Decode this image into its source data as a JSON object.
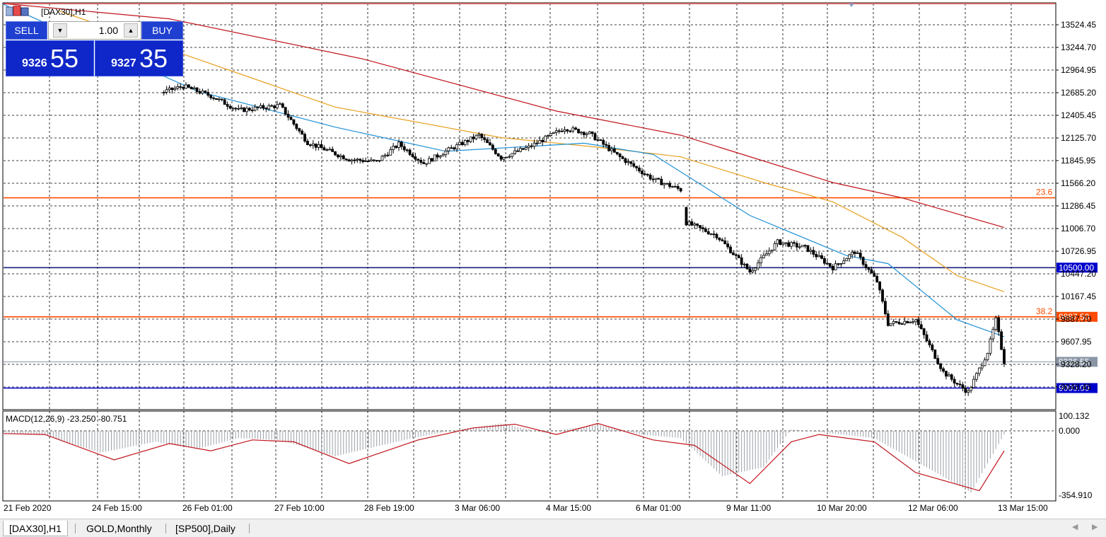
{
  "window": {
    "symbol_title": "[DAX30],H1"
  },
  "trade_panel": {
    "sell_label": "SELL",
    "buy_label": "BUY",
    "lot_value": "1.00",
    "sell_price_small": "9326",
    "sell_price_big": "55",
    "buy_price_small": "9327",
    "buy_price_big": "35"
  },
  "tabs": [
    {
      "label": "[DAX30],H1",
      "active": true
    },
    {
      "label": "GOLD,Monthly",
      "active": false
    },
    {
      "label": "[SP500],Daily",
      "active": false
    }
  ],
  "chart_data": {
    "type": "candlestick",
    "symbol": "[DAX30],H1",
    "ylim": [
      8900,
      13800
    ],
    "y_ticks": [
      "13524.45",
      "13244.70",
      "12964.95",
      "12685.20",
      "12405.45",
      "12125.70",
      "11845.95",
      "11566.20",
      "11286.45",
      "11006.70",
      "10726.95",
      "10447.20",
      "10167.45",
      "9887.70",
      "9607.95",
      "9328.20",
      "9048.45"
    ],
    "x_tick_labels": [
      "21 Feb 2020",
      "24 Feb 15:00",
      "26 Feb 01:00",
      "27 Feb 10:00",
      "28 Feb 19:00",
      "3 Mar 06:00",
      "4 Mar 15:00",
      "6 Mar 01:00",
      "9 Mar 11:00",
      "10 Mar 20:00",
      "12 Mar 06:00",
      "13 Mar 15:00"
    ],
    "price_path": [
      {
        "bar": 0,
        "price": 13700
      },
      {
        "bar": 25,
        "price": 13500
      },
      {
        "bar": 45,
        "price": 12900
      },
      {
        "bar": 57,
        "price": 12680
      },
      {
        "bar": 65,
        "price": 12760
      },
      {
        "bar": 75,
        "price": 12640
      },
      {
        "bar": 85,
        "price": 12460
      },
      {
        "bar": 100,
        "price": 12520
      },
      {
        "bar": 110,
        "price": 12060
      },
      {
        "bar": 125,
        "price": 11850
      },
      {
        "bar": 135,
        "price": 11820
      },
      {
        "bar": 143,
        "price": 12040
      },
      {
        "bar": 152,
        "price": 11800
      },
      {
        "bar": 160,
        "price": 11950
      },
      {
        "bar": 172,
        "price": 12150
      },
      {
        "bar": 180,
        "price": 11870
      },
      {
        "bar": 190,
        "price": 12000
      },
      {
        "bar": 203,
        "price": 12240
      },
      {
        "bar": 212,
        "price": 12170
      },
      {
        "bar": 222,
        "price": 11900
      },
      {
        "bar": 235,
        "price": 11600
      },
      {
        "bar": 245,
        "price": 11470
      },
      {
        "bar": 247,
        "price": 11060
      },
      {
        "bar": 258,
        "price": 10900
      },
      {
        "bar": 270,
        "price": 10450
      },
      {
        "bar": 280,
        "price": 10820
      },
      {
        "bar": 290,
        "price": 10750
      },
      {
        "bar": 300,
        "price": 10500
      },
      {
        "bar": 308,
        "price": 10700
      },
      {
        "bar": 316,
        "price": 10330
      },
      {
        "bar": 320,
        "price": 9800
      },
      {
        "bar": 330,
        "price": 9850
      },
      {
        "bar": 340,
        "price": 9200
      },
      {
        "bar": 345,
        "price": 9050
      },
      {
        "bar": 349,
        "price": 8950
      },
      {
        "bar": 356,
        "price": 9450
      },
      {
        "bar": 359,
        "price": 9850
      },
      {
        "bar": 362,
        "price": 9326
      }
    ],
    "ma_fast_path": [
      {
        "bar": 0,
        "price": 13780
      },
      {
        "bar": 70,
        "price": 12700
      },
      {
        "bar": 120,
        "price": 12250
      },
      {
        "bar": 160,
        "price": 11950
      },
      {
        "bar": 210,
        "price": 12050
      },
      {
        "bar": 235,
        "price": 11910
      },
      {
        "bar": 270,
        "price": 11150
      },
      {
        "bar": 305,
        "price": 10650
      },
      {
        "bar": 320,
        "price": 10550
      },
      {
        "bar": 345,
        "price": 9850
      },
      {
        "bar": 362,
        "price": 9640
      }
    ],
    "ma_mid_path": [
      {
        "bar": 20,
        "price": 13700
      },
      {
        "bar": 120,
        "price": 12500
      },
      {
        "bar": 180,
        "price": 12120
      },
      {
        "bar": 215,
        "price": 12000
      },
      {
        "bar": 245,
        "price": 11880
      },
      {
        "bar": 275,
        "price": 11560
      },
      {
        "bar": 300,
        "price": 11320
      },
      {
        "bar": 325,
        "price": 10880
      },
      {
        "bar": 345,
        "price": 10400
      },
      {
        "bar": 362,
        "price": 10200
      }
    ],
    "ma_slow_path": [
      {
        "bar": 0,
        "price": 13790
      },
      {
        "bar": 60,
        "price": 13600
      },
      {
        "bar": 130,
        "price": 13100
      },
      {
        "bar": 200,
        "price": 12450
      },
      {
        "bar": 245,
        "price": 12150
      },
      {
        "bar": 300,
        "price": 11560
      },
      {
        "bar": 325,
        "price": 11370
      },
      {
        "bar": 362,
        "price": 11000
      }
    ],
    "levels": [
      {
        "name": "23.6",
        "price": 11370,
        "color": "#ff4a00",
        "label": "23.6",
        "tag": ""
      },
      {
        "name": "38.2",
        "price": 9887.5,
        "color": "#ff4a00",
        "label": "38.2",
        "tag": "9887.50",
        "tag_bg": "#ff4a00"
      },
      {
        "name": "10500",
        "price": 10500,
        "color": "#1a237e",
        "label": "",
        "tag": "10500.00",
        "tag_bg": "#0000cc"
      },
      {
        "name": "9000",
        "price": 9000,
        "color": "#0000cc",
        "label": "",
        "tag": "9000.00",
        "tag_bg": "#0000cc"
      },
      {
        "name": "bid",
        "price": 9326.55,
        "color": "#8a96a6",
        "label": "",
        "tag": "9326.55",
        "tag_bg": "#8a96a6"
      }
    ],
    "macd": {
      "label": "MACD(12,26,9) -23.250 -80.751",
      "y_ticks": [
        "100.132",
        "0.000",
        "-354.910"
      ],
      "ylim": [
        -354.91,
        100.132
      ],
      "histogram_path": [
        {
          "bar": 0,
          "v": -10
        },
        {
          "bar": 15,
          "v": -25
        },
        {
          "bar": 35,
          "v": -120
        },
        {
          "bar": 55,
          "v": -60
        },
        {
          "bar": 70,
          "v": -100
        },
        {
          "bar": 85,
          "v": -40
        },
        {
          "bar": 100,
          "v": -50
        },
        {
          "bar": 120,
          "v": -140
        },
        {
          "bar": 145,
          "v": -50
        },
        {
          "bar": 165,
          "v": 10
        },
        {
          "bar": 180,
          "v": 50
        },
        {
          "bar": 195,
          "v": -10
        },
        {
          "bar": 215,
          "v": 40
        },
        {
          "bar": 230,
          "v": -20
        },
        {
          "bar": 245,
          "v": -40
        },
        {
          "bar": 260,
          "v": -250
        },
        {
          "bar": 275,
          "v": -200
        },
        {
          "bar": 285,
          "v": 10
        },
        {
          "bar": 300,
          "v": -15
        },
        {
          "bar": 315,
          "v": -40
        },
        {
          "bar": 335,
          "v": -210
        },
        {
          "bar": 350,
          "v": -340
        },
        {
          "bar": 362,
          "v": -20
        }
      ],
      "signal_path": [
        {
          "bar": 0,
          "v": -15
        },
        {
          "bar": 15,
          "v": -20
        },
        {
          "bar": 40,
          "v": -160
        },
        {
          "bar": 60,
          "v": -70
        },
        {
          "bar": 75,
          "v": -110
        },
        {
          "bar": 90,
          "v": -50
        },
        {
          "bar": 105,
          "v": -60
        },
        {
          "bar": 125,
          "v": -180
        },
        {
          "bar": 150,
          "v": -50
        },
        {
          "bar": 170,
          "v": 20
        },
        {
          "bar": 185,
          "v": 45
        },
        {
          "bar": 200,
          "v": -20
        },
        {
          "bar": 215,
          "v": 50
        },
        {
          "bar": 235,
          "v": -50
        },
        {
          "bar": 250,
          "v": -80
        },
        {
          "bar": 270,
          "v": -290
        },
        {
          "bar": 285,
          "v": -60
        },
        {
          "bar": 295,
          "v": -20
        },
        {
          "bar": 315,
          "v": -60
        },
        {
          "bar": 330,
          "v": -230
        },
        {
          "bar": 353,
          "v": -330
        },
        {
          "bar": 362,
          "v": -110
        }
      ]
    }
  }
}
